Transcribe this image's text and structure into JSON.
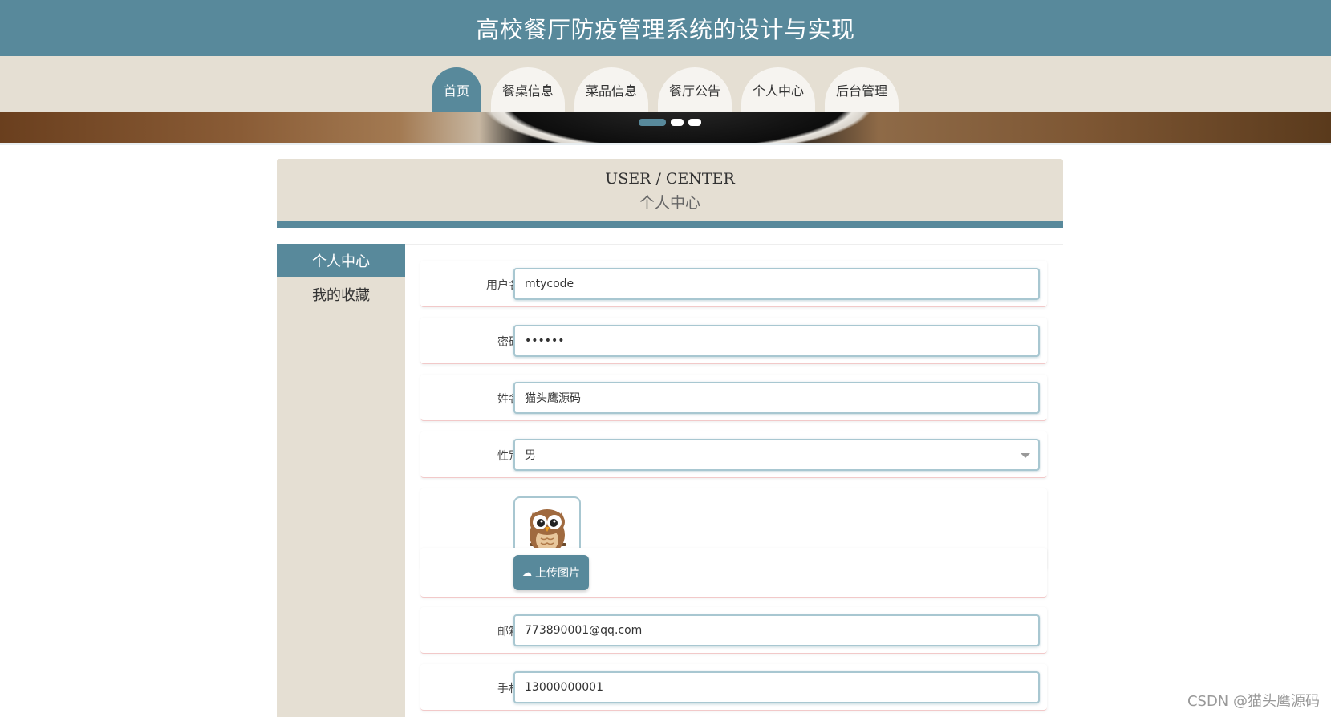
{
  "header": {
    "title": "高校餐厅防疫管理系统的设计与实现"
  },
  "nav": {
    "items": [
      {
        "label": "首页",
        "active": true
      },
      {
        "label": "餐桌信息",
        "active": false
      },
      {
        "label": "菜品信息",
        "active": false
      },
      {
        "label": "餐厅公告",
        "active": false
      },
      {
        "label": "个人中心",
        "active": false
      },
      {
        "label": "后台管理",
        "active": false
      }
    ]
  },
  "carousel": {
    "slides": 3,
    "active": 0
  },
  "section": {
    "title_en": "USER / CENTER",
    "title_cn": "个人中心"
  },
  "sidebar": {
    "items": [
      {
        "label": "个人中心",
        "active": true
      },
      {
        "label": "我的收藏",
        "active": false
      }
    ]
  },
  "form": {
    "username": {
      "label": "用户名",
      "value": "mtycode"
    },
    "password": {
      "label": "密码",
      "value": "••••••"
    },
    "name": {
      "label": "姓名",
      "value": "猫头鹰源码"
    },
    "gender": {
      "label": "性别",
      "value": "男"
    },
    "avatar": {
      "icon": "owl-avatar"
    },
    "upload": {
      "label": "上传图片",
      "icon": "cloud-upload-icon"
    },
    "email": {
      "label": "邮箱",
      "value": "773890001@qq.com"
    },
    "phone": {
      "label": "手机",
      "value": "13000000001"
    }
  },
  "watermark": "CSDN @猫头鹰源码",
  "colors": {
    "primary": "#58899b",
    "beige": "#e5dfd3"
  }
}
